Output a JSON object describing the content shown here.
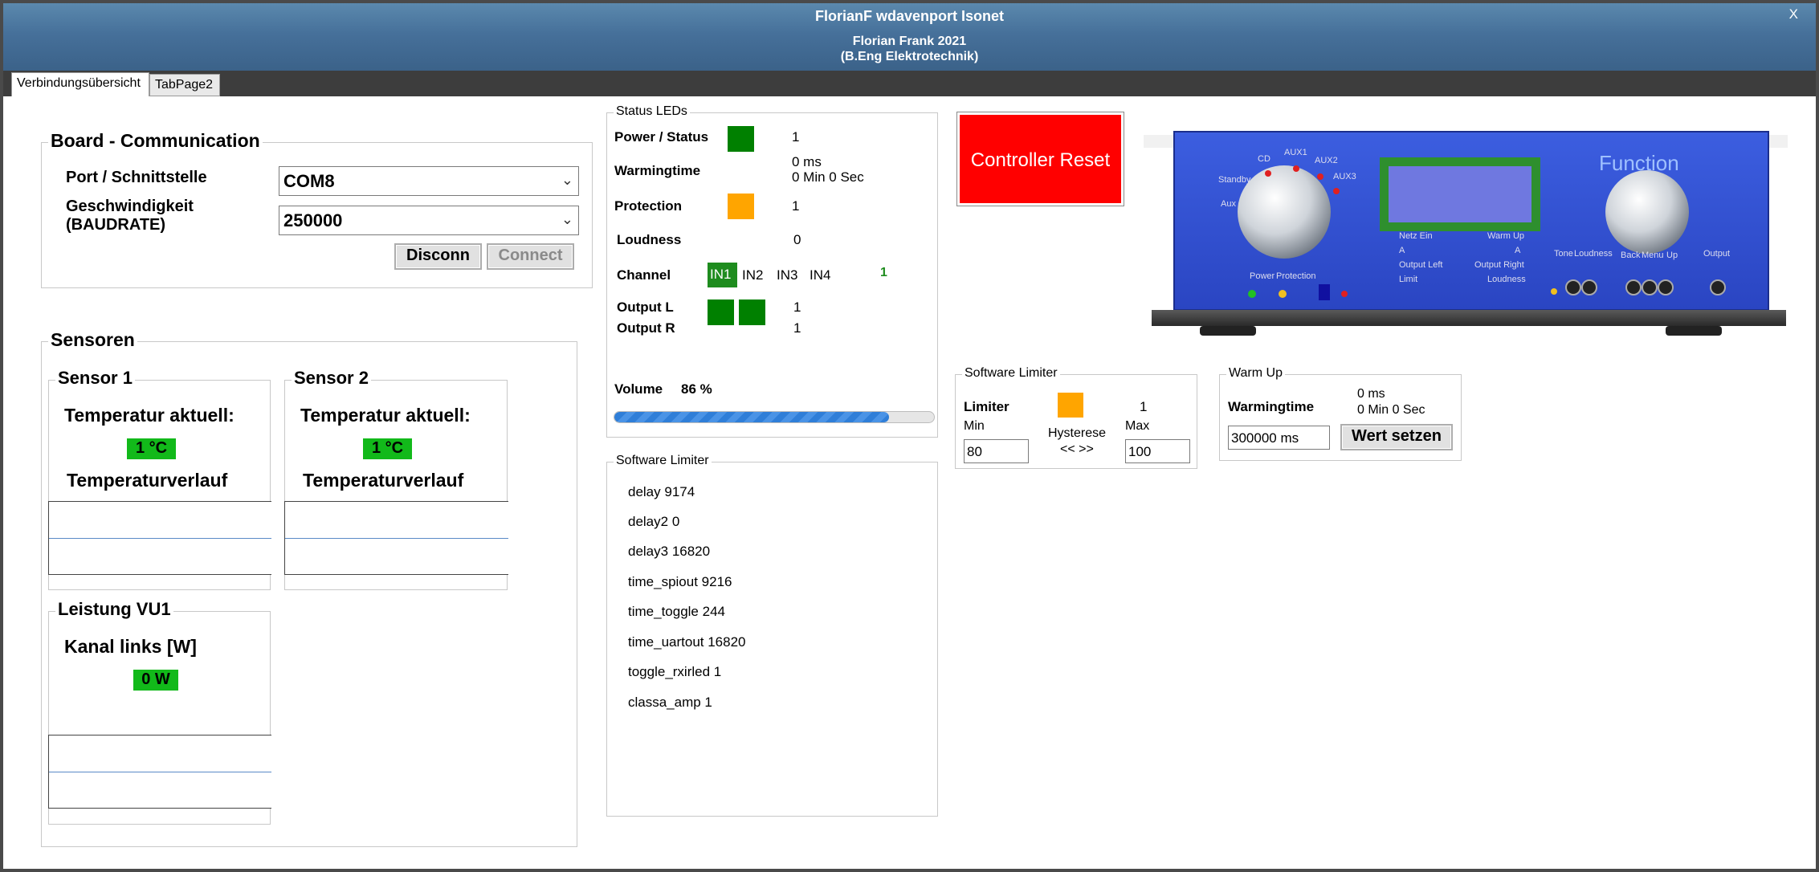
{
  "window": {
    "title": "FlorianF wdavenport Isonet",
    "subtitle1": "Florian Frank 2021",
    "subtitle2": "(B.Eng Elektrotechnik)",
    "close": "X"
  },
  "tabs": [
    {
      "label": "Verbindungsübersicht",
      "active": true
    },
    {
      "label": "TabPage2",
      "active": false
    }
  ],
  "board": {
    "title": "Board - Communication",
    "port_label": "Port / Schnittstelle",
    "port_value": "COM8",
    "baud_label_1": "Geschwindigkeit",
    "baud_label_2": "(BAUDRATE)",
    "baud_value": "250000",
    "disconnect": "Disconn",
    "connect": "Connect"
  },
  "sensoren": {
    "title": "Sensoren",
    "sensor1": {
      "title": "Sensor 1",
      "temp_label": "Temperatur aktuell:",
      "temp_value": "1 °C",
      "history_label": "Temperaturverlauf"
    },
    "sensor2": {
      "title": "Sensor 2",
      "temp_label": "Temperatur aktuell:",
      "temp_value": "1 °C",
      "history_label": "Temperaturverlauf"
    },
    "vu": {
      "title": "Leistung VU1",
      "label": "Kanal links [W]",
      "value": "0 W"
    }
  },
  "status": {
    "title": "Status LEDs",
    "power_label": "Power / Status",
    "power_value": "1",
    "power_color": "#008000",
    "warming_label": "Warmingtime",
    "warming_ms": "0 ms",
    "warming_min": "0 Min 0 Sec",
    "protection_label": "Protection",
    "protection_value": "1",
    "protection_color": "#ffa500",
    "loudness_label": "Loudness",
    "loudness_value": "0",
    "channel_label": "Channel",
    "channels": [
      "IN1",
      "IN2",
      "IN3",
      "IN4"
    ],
    "channel_value": "1",
    "output_l_label": "Output L",
    "output_l_value": "1",
    "output_r_label": "Output R",
    "output_r_value": "1",
    "volume_label": "Volume",
    "volume_value": "86 %",
    "volume_fraction": 0.86
  },
  "debug": {
    "title": "Software Limiter",
    "lines": [
      "delay 9174",
      "delay2 0",
      "delay3 16820",
      "time_spiout 9216",
      "time_toggle 244",
      "time_uartout 16820",
      "toggle_rxirled 1",
      "classa_amp 1"
    ]
  },
  "controller_reset": "Controller Reset",
  "device": {
    "function": "Function",
    "labels": {
      "cd": "CD",
      "aux1": "AUX1",
      "aux2": "AUX2",
      "aux3": "AUX3",
      "standby": "Standby",
      "aux": "Aux",
      "netz": "Netz Ein",
      "a": "A",
      "output_left": "Output Left",
      "limit": "Limit",
      "warm_up": "Warm Up",
      "a2": "A",
      "output_right": "Output Right",
      "loudness": "Loudness",
      "power": "Power",
      "protection": "Protection",
      "tone": "Tone",
      "loudness2": "Loudness",
      "back": "Back",
      "menu": "Menu",
      "up": "Up",
      "output": "Output"
    }
  },
  "limiter": {
    "title": "Software Limiter",
    "label": "Limiter",
    "value": "1",
    "color": "#ffa500",
    "min_label": "Min",
    "min_value": "80",
    "hyst_label": "Hysterese",
    "hyst_arrows": "<< >>",
    "max_label": "Max",
    "max_value": "100"
  },
  "warmup": {
    "title": "Warm Up",
    "label": "Warmingtime",
    "ms": "0 ms",
    "min": "0 Min 0 Sec",
    "input_value": "300000 ms",
    "button": "Wert setzen"
  }
}
